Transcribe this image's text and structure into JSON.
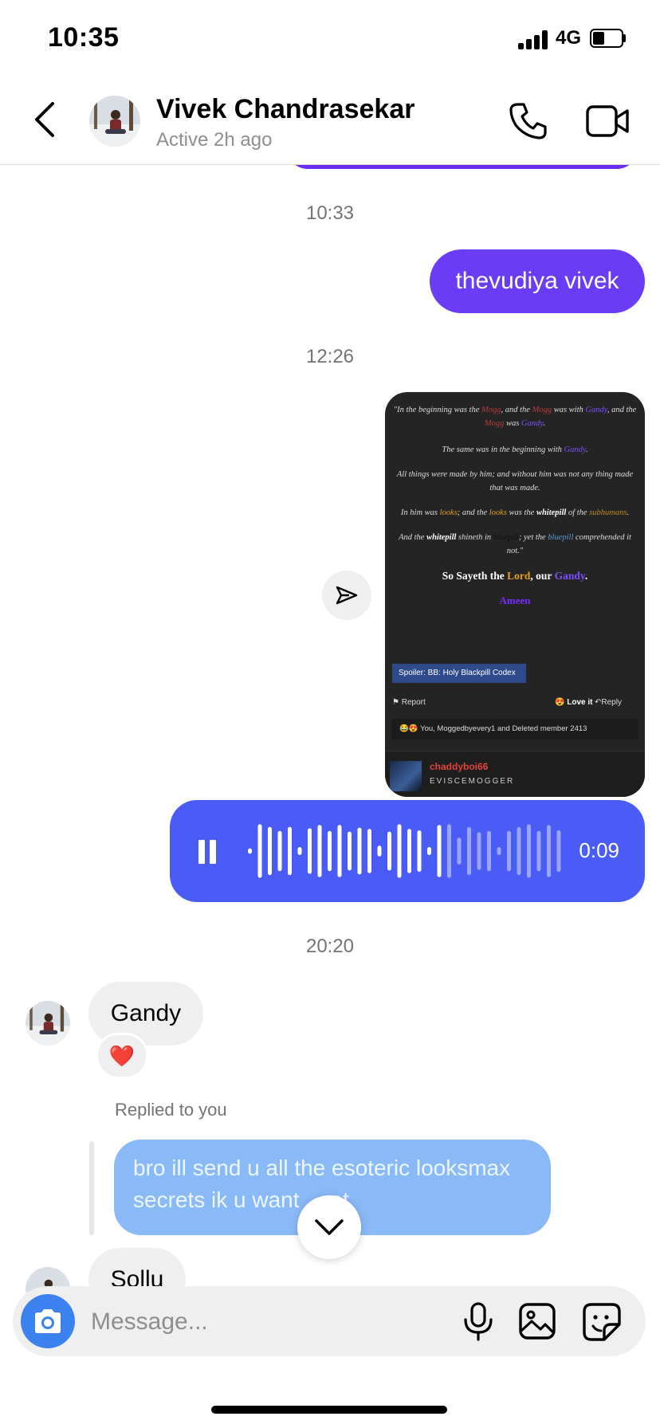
{
  "status_bar": {
    "time": "10:35",
    "network": "4G"
  },
  "header": {
    "name": "Vivek Chandrasekar",
    "status": "Active 2h ago"
  },
  "timestamps": [
    "10:33",
    "12:26",
    "20:20"
  ],
  "messages": {
    "sent_text": "thevudiya vivek",
    "voice": {
      "duration": "0:09",
      "progress": 0.6
    },
    "received_1": "Gandy",
    "received_1_reaction": "❤️",
    "reply_label": "Replied to you",
    "reply_quote": "bro ill send u all the esoteric looksmax secrets ik u want ... ot",
    "received_2": "Sollu"
  },
  "shared_card": {
    "l1a": "\"In the beginning was the ",
    "l1b": "Mogg",
    "l1c": ", and the ",
    "l1d": "Mogg",
    "l1e": " was with ",
    "l1f": "Gandy",
    "l1g": ",",
    "l2a": "and the ",
    "l2b": "Mogg",
    "l2c": " was ",
    "l2d": "Gandy",
    "l2e": ".",
    "l3a": "The same was in the beginning with ",
    "l3b": "Gandy",
    "l3c": ".",
    "l4": "All things were made by him; and without him was not any thing made that was made.",
    "l5a": "In him was ",
    "l5b": "looks",
    "l5c": "; and the ",
    "l5d": "looks",
    "l5e": " was the ",
    "l5f": "whitepill",
    "l5g": " of the ",
    "l5h": "subhumans",
    "l5i": ".",
    "l6a": "And the ",
    "l6b": "whitepill",
    "l6c": " shineth in ",
    "l6d": "bluepill",
    "l6e": "; yet the ",
    "l6f": "bluepill",
    "l6g": " comprehended it not.\"",
    "sayeth_a": "So Sayeth the ",
    "sayeth_b": "Lord",
    "sayeth_c": ", our ",
    "sayeth_d": "Gandy",
    "sayeth_e": ".",
    "ameen": "Ameen",
    "spoiler": "Spoiler: BB: Holy Blackpill Codex",
    "report": "Report",
    "love": "Love it",
    "reply": "Reply",
    "reactions": "You, Moggedbyevery1 and Deleted member 2413",
    "username": "chaddyboi66",
    "user_title": "EVISCEMOGGER"
  },
  "composer": {
    "placeholder": "Message..."
  },
  "icons": [
    "back-icon",
    "phone-icon",
    "video-icon",
    "share-icon",
    "pause-icon",
    "chevron-down-icon",
    "camera-icon",
    "mic-icon",
    "gallery-icon",
    "sticker-icon"
  ],
  "colors": {
    "sent_bubble": "#6a3cf6",
    "voice_bubble": "#4a5cf5",
    "reply_bubble": "#8ab9f7",
    "camera": "#3b82f0"
  }
}
